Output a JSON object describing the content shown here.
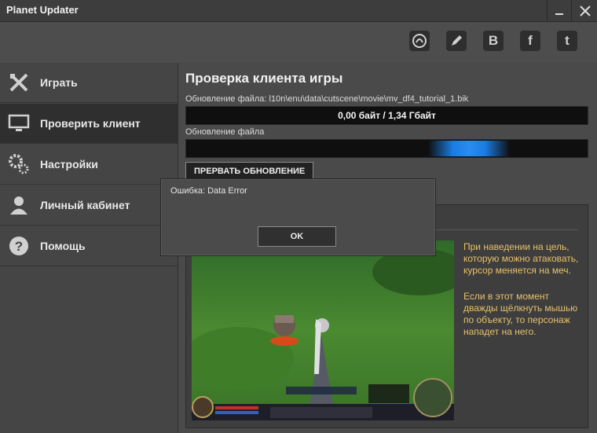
{
  "window": {
    "title": "Planet Updater"
  },
  "toolbar": {
    "social": [
      "forum-icon",
      "edit-icon",
      "vk-icon",
      "facebook-icon",
      "twitter-icon"
    ],
    "vk_glyph": "B",
    "fb_glyph": "f",
    "tw_glyph": "t"
  },
  "sidebar": {
    "items": [
      {
        "label": "Играть",
        "icon": "play-swords-icon"
      },
      {
        "label": "Проверить клиент",
        "icon": "monitor-icon"
      },
      {
        "label": "Настройки",
        "icon": "gears-icon"
      },
      {
        "label": "Личный кабинет",
        "icon": "user-icon"
      },
      {
        "label": "Помощь",
        "icon": "help-icon",
        "glyph": "?"
      }
    ]
  },
  "main": {
    "title": "Проверка клиента игры",
    "file_label": "Обновление файла: l10n\\enu\\data\\cutscene\\movie\\mv_df4_tutorial_1.bik",
    "progress_text": "0,00 байт / 1,34 Гбайт",
    "file_label2": "Обновление файла",
    "abort_button": "ПРЕРВАТЬ ОБНОВЛЕНИЕ",
    "tip1": "При наведении на цель, которую можно атаковать, курсор меняется на меч.",
    "tip2": "Если в этот момент дважды щёлкнуть мышью по объекту, то персонаж нападет на него."
  },
  "dialog": {
    "message": "Ошибка: Data Error",
    "ok_label": "OK"
  }
}
